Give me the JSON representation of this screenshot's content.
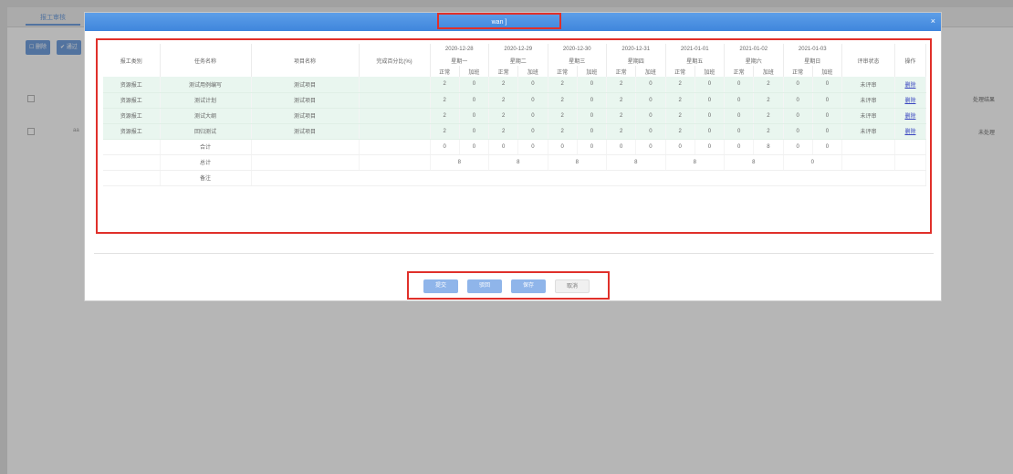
{
  "background": {
    "tab_label": "报工审核",
    "buttons": [
      "☐ 删除",
      "✔ 通过"
    ],
    "row_right_labels": [
      "处理结果",
      "未处理"
    ],
    "row_left_label": "aa"
  },
  "modal": {
    "title": "wan                ]",
    "close_icon": "×"
  },
  "table": {
    "headers": {
      "type": "报工类别",
      "task": "任务名称",
      "project": "项目名称",
      "percent": "完成百分比(%)",
      "status": "评审状态",
      "action": "操作"
    },
    "days": [
      {
        "date": "2020-12-28",
        "weekday": "星期一"
      },
      {
        "date": "2020-12-29",
        "weekday": "星期二"
      },
      {
        "date": "2020-12-30",
        "weekday": "星期三"
      },
      {
        "date": "2020-12-31",
        "weekday": "星期四"
      },
      {
        "date": "2021-01-01",
        "weekday": "星期五"
      },
      {
        "date": "2021-01-02",
        "weekday": "星期六"
      },
      {
        "date": "2021-01-03",
        "weekday": "星期日"
      }
    ],
    "sub_normal": "正常",
    "sub_overtime": "加班",
    "rows": [
      {
        "type": "资源报工",
        "task": "测试用例编写",
        "project": "测试项目",
        "percent": "",
        "hours": [
          "2",
          "0",
          "2",
          "0",
          "2",
          "0",
          "2",
          "0",
          "2",
          "0",
          "0",
          "2",
          "0",
          "0"
        ],
        "status": "未评审",
        "action": "删除"
      },
      {
        "type": "资源报工",
        "task": "测试计划",
        "project": "测试项目",
        "percent": "",
        "hours": [
          "2",
          "0",
          "2",
          "0",
          "2",
          "0",
          "2",
          "0",
          "2",
          "0",
          "0",
          "2",
          "0",
          "0"
        ],
        "status": "未评审",
        "action": "删除"
      },
      {
        "type": "资源报工",
        "task": "测试大纲",
        "project": "测试项目",
        "percent": "",
        "hours": [
          "2",
          "0",
          "2",
          "0",
          "2",
          "0",
          "2",
          "0",
          "2",
          "0",
          "0",
          "2",
          "0",
          "0"
        ],
        "status": "未评审",
        "action": "删除"
      },
      {
        "type": "资源报工",
        "task": "回归测试",
        "project": "测试项目",
        "percent": "",
        "hours": [
          "2",
          "0",
          "2",
          "0",
          "2",
          "0",
          "2",
          "0",
          "2",
          "0",
          "0",
          "2",
          "0",
          "0"
        ],
        "status": "未评审",
        "action": "删除"
      }
    ],
    "subtotal_label": "合计",
    "subtotal": [
      "0",
      "0",
      "0",
      "0",
      "0",
      "0",
      "0",
      "0",
      "0",
      "0",
      "0",
      "8",
      "0",
      "0"
    ],
    "total_label": "总计",
    "totals": [
      "8",
      "8",
      "8",
      "8",
      "8",
      "8",
      "0"
    ],
    "remark_label": "备注"
  },
  "footer": {
    "submit": "提交",
    "reject": "驳回",
    "save": "保存",
    "cancel": "取消"
  }
}
